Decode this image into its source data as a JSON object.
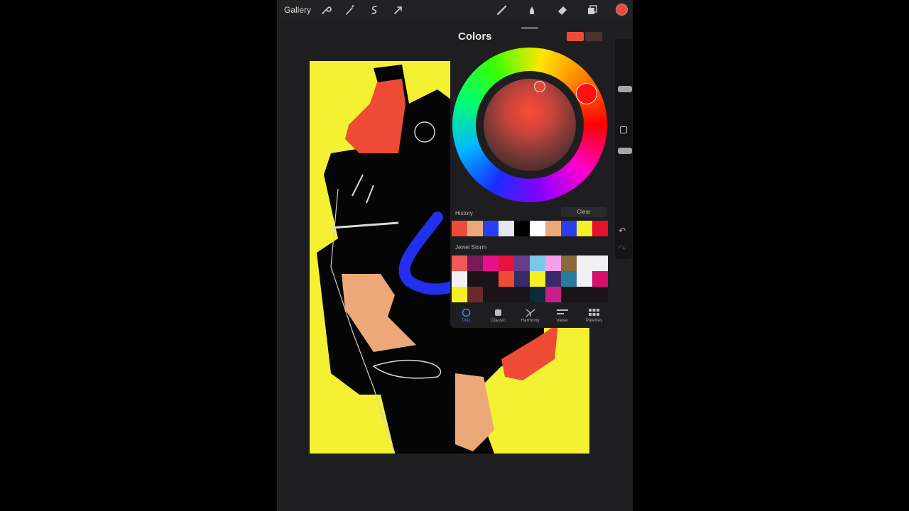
{
  "topbar": {
    "gallery_label": "Gallery",
    "left_tools": [
      "wrench-icon",
      "magic-wand-icon",
      "selection-icon",
      "transform-arrow-icon"
    ],
    "right_tools": [
      "brush-icon",
      "smudge-icon",
      "eraser-icon",
      "layers-icon"
    ],
    "current_color": "#ee4b36"
  },
  "colors_panel": {
    "title": "Colors",
    "current_swatch": "#ee4b36",
    "previous_swatch": "#4a3330",
    "history": {
      "label": "History",
      "clear_label": "Clear",
      "swatches": [
        "#ee4b36",
        "#eda877",
        "#2a3ef0",
        "#e6e6f0",
        "#000000",
        "#ffffff",
        "#eda877",
        "#2a3ef0",
        "#f5f023",
        "#e8102e"
      ]
    },
    "palette": {
      "name": "Jewel Storm",
      "rows": [
        [
          "#ee5b56",
          "#7a1a5a",
          "#e8108a",
          "#e8123a",
          "#6a3a8e",
          "#7ac8e8",
          "#f5a0e8",
          "#8a6a3a",
          "#f0f0f5",
          "#f0f0f5"
        ],
        [
          "#f0f0f5",
          "#1a1418",
          "#1a1418",
          "#ee4b36",
          "#3a2a6a",
          "#f5f023",
          "#3a2a6a",
          "#2a7a9a",
          "#f0f0f5",
          "#d80e6e"
        ],
        [
          "#f5f023",
          "#6a2a2a",
          "#1a1418",
          "#1a1418",
          "#1a1418",
          "#0e2a3e",
          "#c81e8a",
          "#1a1418",
          "#1a1418",
          "#1a1418"
        ]
      ]
    },
    "tabs": [
      {
        "label": "Disc",
        "icon": "disc-icon",
        "active": true
      },
      {
        "label": "Classic",
        "icon": "classic-square-icon",
        "active": false
      },
      {
        "label": "Harmony",
        "icon": "harmony-icon",
        "active": false
      },
      {
        "label": "Value",
        "icon": "value-sliders-icon",
        "active": false
      },
      {
        "label": "Palettes",
        "icon": "palettes-grid-icon",
        "active": false
      }
    ]
  },
  "sidebar": {
    "brush_size_slider": "brush-size-slider",
    "modify_button": "modify-square-icon",
    "opacity_slider": "opacity-slider",
    "undo_icon": "undo-icon",
    "redo_icon": "redo-icon"
  }
}
